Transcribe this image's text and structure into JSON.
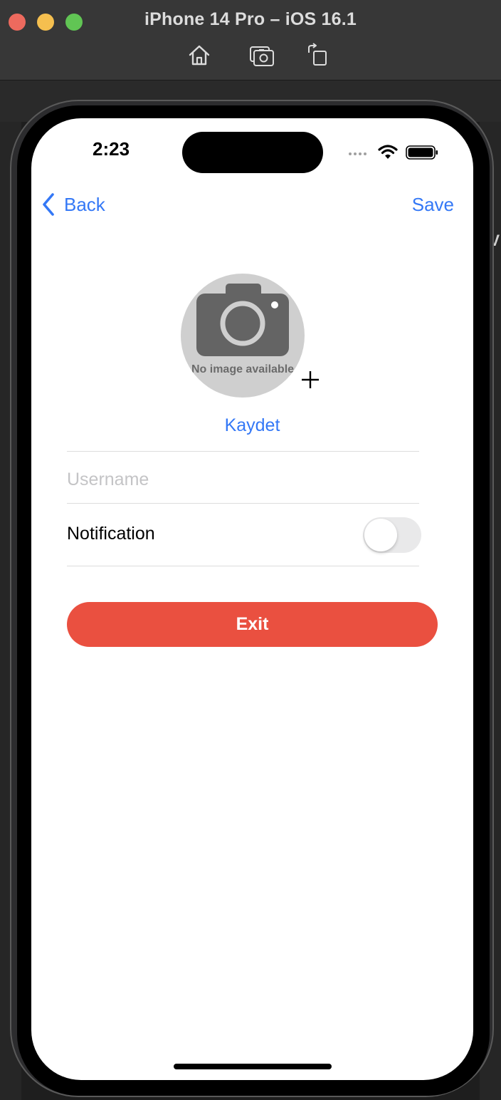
{
  "simulator": {
    "title": "iPhone 14 Pro – iOS 16.1",
    "tools": [
      "home-icon",
      "screenshot-icon",
      "rotate-icon"
    ]
  },
  "status_bar": {
    "time": "2:23"
  },
  "nav": {
    "back_label": "Back",
    "save_label": "Save"
  },
  "profile": {
    "avatar_caption": "No image available",
    "photo_button_label": "Kaydet"
  },
  "form": {
    "username_value": "",
    "username_placeholder": "Username",
    "notification_label": "Notification",
    "notification_enabled": false
  },
  "actions": {
    "exit_label": "Exit"
  },
  "colors": {
    "accent": "#3478f6",
    "exit_button": "#ea5040",
    "toggle_off": "#e9e9ea",
    "avatar_bg": "#cfcfcf"
  },
  "background": {
    "right_edge_letter": "V"
  }
}
